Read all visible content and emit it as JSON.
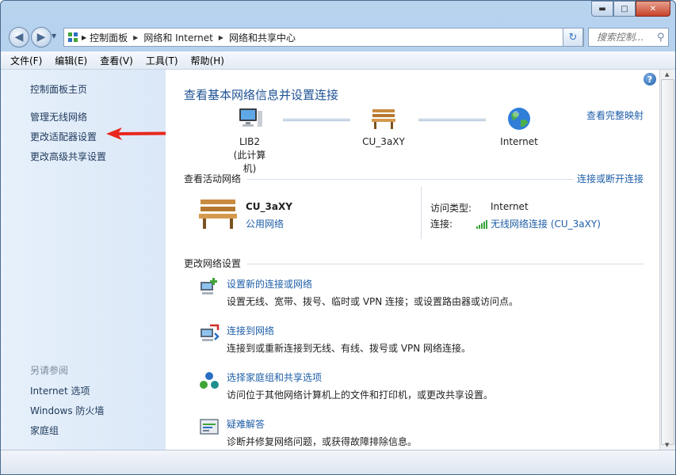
{
  "window": {
    "caption_buttons": [
      {
        "name": "minimize-button",
        "glyph": "▬"
      },
      {
        "name": "maximize-button",
        "glyph": "□"
      },
      {
        "name": "close-button",
        "glyph": "✕"
      }
    ]
  },
  "nav": {
    "back_glyph": "◀",
    "forward_glyph": "▶",
    "breadcrumb": [
      "控制面板",
      "网络和 Internet",
      "网络和共享中心"
    ],
    "search_placeholder": "搜索控制...",
    "refresh_glyph": "↻"
  },
  "menu": [
    "文件(F)",
    "编辑(E)",
    "查看(V)",
    "工具(T)",
    "帮助(H)"
  ],
  "left_pane": {
    "home": "控制面板主页",
    "links": [
      "管理无线网络",
      "更改适配器设置",
      "更改高级共享设置"
    ],
    "see_also_title": "另请参阅",
    "see_also": [
      "Internet 选项",
      "Windows 防火墙",
      "家庭组"
    ]
  },
  "main": {
    "help_glyph": "?",
    "title": "查看基本网络信息并设置连接",
    "full_map": "查看完整映射",
    "map": {
      "computer": {
        "name": "LIB2",
        "sub": "(此计算机)"
      },
      "network": "CU_3aXY",
      "internet": "Internet"
    },
    "active": {
      "section_title": "查看活动网络",
      "connect_link": "连接或断开连接",
      "network_name": "CU_3aXY",
      "network_type": "公用网络",
      "access_label": "访问类型:",
      "access_value": "Internet",
      "conn_label": "连接:",
      "conn_value": "无线网络连接 (CU_3aXY)"
    },
    "change": {
      "section_title": "更改网络设置",
      "tasks": [
        {
          "label": "设置新的连接或网络",
          "desc": "设置无线、宽带、拨号、临时或 VPN 连接；或设置路由器或访问点。"
        },
        {
          "label": "连接到网络",
          "desc": "连接到或重新连接到无线、有线、拨号或 VPN 网络连接。"
        },
        {
          "label": "选择家庭组和共享选项",
          "desc": "访问位于其他网络计算机上的文件和打印机，或更改共享设置。"
        },
        {
          "label": "疑难解答",
          "desc": "诊断并修复网络问题，或获得故障排除信息。"
        }
      ]
    }
  },
  "colors": {
    "link": "#1e5ea8",
    "title": "#1e5294",
    "annotation_arrow": "#e8281e"
  }
}
